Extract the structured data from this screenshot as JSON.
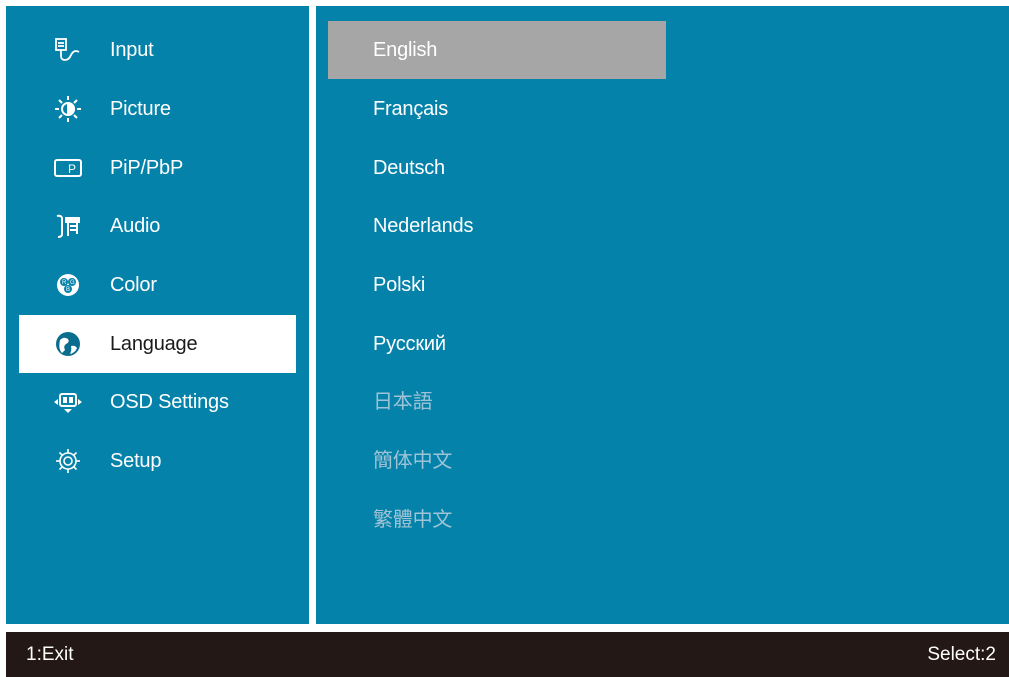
{
  "menu": {
    "items": [
      {
        "label": "Input",
        "icon": "input-icon"
      },
      {
        "label": "Picture",
        "icon": "brightness-icon"
      },
      {
        "label": "PiP/PbP",
        "icon": "pip-icon"
      },
      {
        "label": "Audio",
        "icon": "audio-icon"
      },
      {
        "label": "Color",
        "icon": "rgb-color-icon"
      },
      {
        "label": "Language",
        "icon": "globe-icon",
        "selected": true
      },
      {
        "label": "OSD Settings",
        "icon": "osd-settings-icon"
      },
      {
        "label": "Setup",
        "icon": "gear-icon"
      }
    ]
  },
  "languages": {
    "items": [
      {
        "label": "English",
        "highlighted": true
      },
      {
        "label": "Français"
      },
      {
        "label": "Deutsch"
      },
      {
        "label": "Nederlands"
      },
      {
        "label": "Polski"
      },
      {
        "label": "Русский"
      },
      {
        "label": "日本語",
        "disabled": true
      },
      {
        "label": "簡体中文",
        "disabled": true
      },
      {
        "label": "繁體中文",
        "disabled": true
      }
    ]
  },
  "footer": {
    "exit_hint": "1:Exit",
    "select_hint": "Select:2"
  },
  "colors": {
    "panel_bg": "#0582a9",
    "footer_bg": "#231815",
    "selected_bg": "#ffffff",
    "highlight_bg": "#a6a6a6"
  }
}
